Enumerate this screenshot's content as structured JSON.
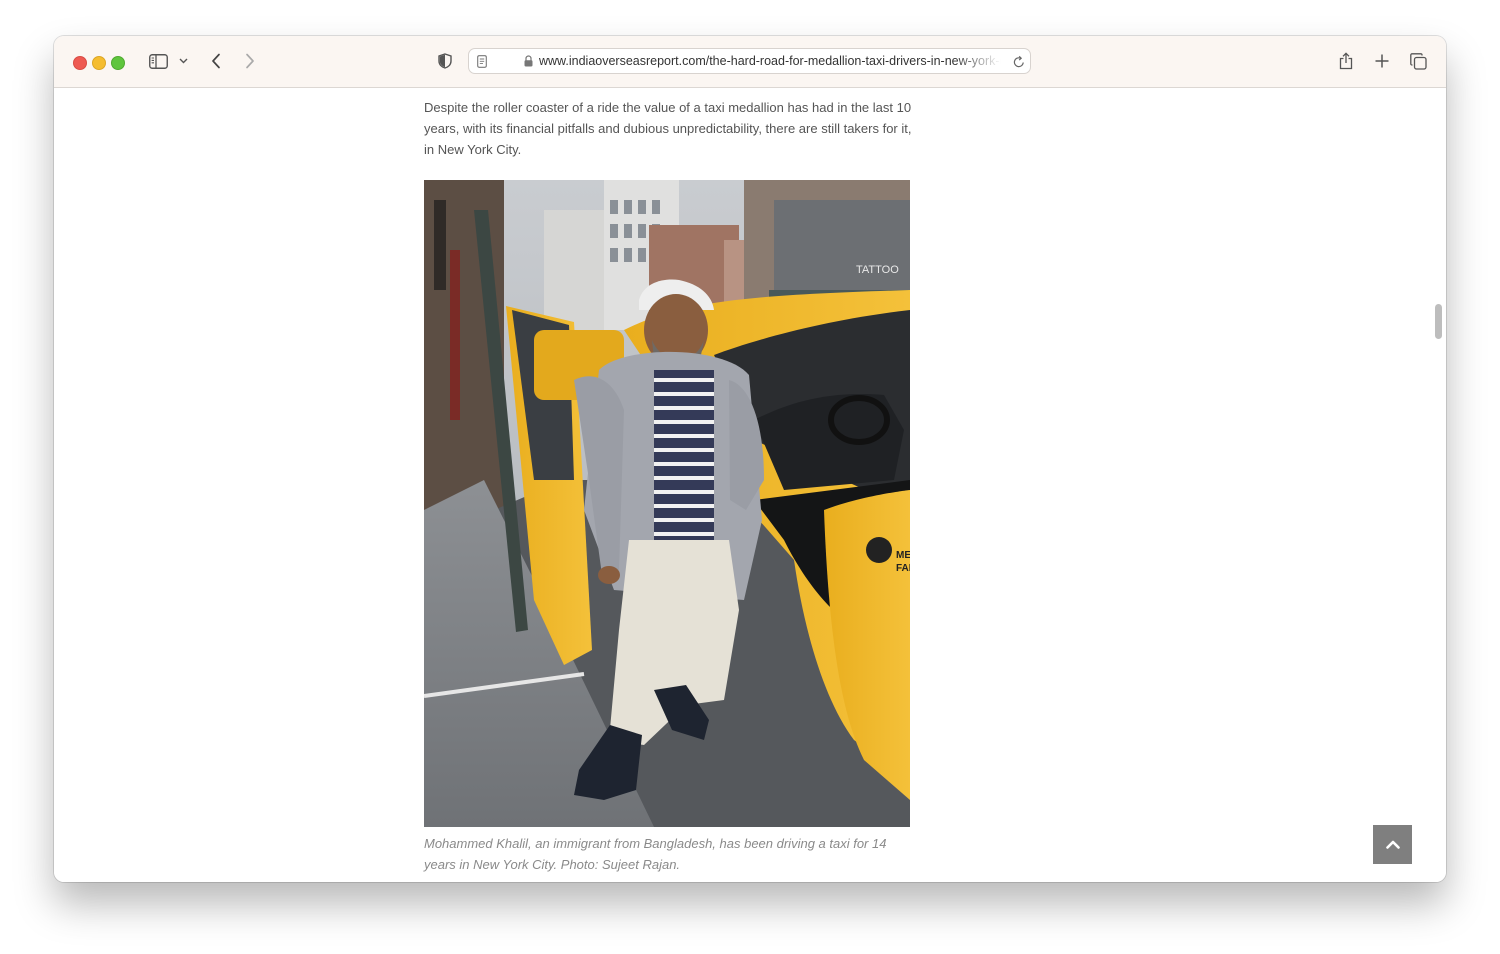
{
  "browser": {
    "url": "www.indiaoverseasreport.com/the-hard-road-for-medallion-taxi-drivers-in-new-york-city/",
    "icons": [
      "sidebar-icon",
      "chevron-down-icon",
      "back-icon",
      "forward-icon",
      "shield-icon",
      "reader-icon",
      "lock-icon",
      "reload-icon",
      "share-icon",
      "plus-icon",
      "tabs-icon"
    ]
  },
  "article": {
    "paragraph": "Despite the roller coaster of a ride the value of a taxi medallion has had in the last 10 years, with its financial pitfalls and dubious unpredictability, there are still takers for it, in New York City.",
    "photo_caption": "Mohammed Khalil, an immigrant from Bangladesh, has been driving a taxi for 14 years in New York City. Photo: Sujeet Rajan.",
    "cab_logo_text": [
      "ME",
      "FAI"
    ],
    "store_sign_text": "TATTOO"
  },
  "controls": {
    "back_to_top_icon": "chevron-up-icon"
  },
  "colors": {
    "toolbar_bg": "#fbf6f2",
    "taxi_yellow": "#f0b928",
    "back_to_top_bg": "#7f7f7f"
  }
}
